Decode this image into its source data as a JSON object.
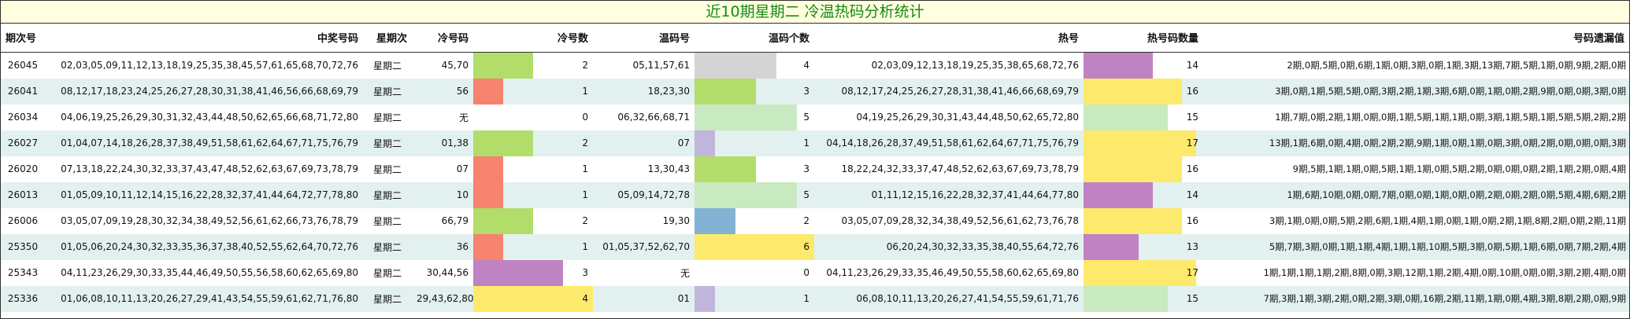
{
  "title": "近10期星期二 冷温热码分析统计",
  "headers": [
    "期次号",
    "中奖号码",
    "星期次",
    "冷号码",
    "冷号数",
    "温码号",
    "温码个数",
    "热号",
    "热号码数量",
    "号码遗漏值"
  ],
  "colors": {
    "green": "#b2dd6a",
    "red": "#f6836d",
    "purple": "#bf82c2",
    "yellow": "#fde96b",
    "gray": "#d4d4d4",
    "light_green": "#c9e9c1",
    "lavender": "#c0b6dd",
    "blue": "#82b3d4"
  },
  "rows": [
    {
      "issue": "26045",
      "numbers": "02,03,05,09,11,12,13,18,19,25,35,38,45,57,61,65,68,70,72,76",
      "weekday": "星期二",
      "cold": "45,70",
      "cold_count": 2,
      "cold_color": "#b2dd6a",
      "warm": "05,11,57,61",
      "warm_count": 4,
      "warm_color": "#d4d4d4",
      "hot": "02,03,09,12,13,18,19,25,35,38,65,68,72,76",
      "hot_count": 14,
      "hot_color": "#bf82c2",
      "missing": "2期,0期,5期,0期,6期,1期,0期,3期,0期,1期,3期,13期,7期,5期,1期,0期,9期,2期,0期"
    },
    {
      "issue": "26041",
      "numbers": "08,12,17,18,23,24,25,26,27,28,30,31,38,41,46,56,66,68,69,79",
      "weekday": "星期二",
      "cold": "56",
      "cold_count": 1,
      "cold_color": "#f6836d",
      "warm": "18,23,30",
      "warm_count": 3,
      "warm_color": "#b2dd6a",
      "hot": "08,12,17,24,25,26,27,28,31,38,41,46,66,68,69,79",
      "hot_count": 16,
      "hot_color": "#fde96b",
      "missing": "3期,0期,1期,5期,5期,0期,3期,2期,1期,3期,6期,0期,1期,0期,2期,9期,0期,0期,3期,0期"
    },
    {
      "issue": "26034",
      "numbers": "04,06,19,25,26,29,30,31,32,43,44,48,50,62,65,66,68,71,72,80",
      "weekday": "星期二",
      "cold": "无",
      "cold_count": 0,
      "cold_color": "#f6836d",
      "warm": "06,32,66,68,71",
      "warm_count": 5,
      "warm_color": "#c9e9c1",
      "hot": "04,19,25,26,29,30,31,43,44,48,50,62,65,72,80",
      "hot_count": 15,
      "hot_color": "#c9e9c1",
      "missing": "1期,7期,0期,2期,1期,0期,0期,1期,5期,1期,1期,0期,3期,1期,5期,1期,5期,5期,2期,2期"
    },
    {
      "issue": "26027",
      "numbers": "01,04,07,14,18,26,28,37,38,49,51,58,61,62,64,67,71,75,76,79",
      "weekday": "星期二",
      "cold": "01,38",
      "cold_count": 2,
      "cold_color": "#b2dd6a",
      "warm": "07",
      "warm_count": 1,
      "warm_color": "#c0b6dd",
      "hot": "04,14,18,26,28,37,49,51,58,61,62,64,67,71,75,76,79",
      "hot_count": 17,
      "hot_color": "#fde96b",
      "missing": "13期,1期,6期,0期,4期,0期,2期,2期,9期,1期,0期,1期,0期,3期,0期,2期,0期,0期,0期,3期"
    },
    {
      "issue": "26020",
      "numbers": "07,13,18,22,24,30,32,33,37,43,47,48,52,62,63,67,69,73,78,79",
      "weekday": "星期二",
      "cold": "07",
      "cold_count": 1,
      "cold_color": "#f6836d",
      "warm": "13,30,43",
      "warm_count": 3,
      "warm_color": "#b2dd6a",
      "hot": "18,22,24,32,33,37,47,48,52,62,63,67,69,73,78,79",
      "hot_count": 16,
      "hot_color": "#fde96b",
      "missing": "9期,5期,1期,1期,0期,5期,1期,1期,0期,5期,2期,0期,0期,0期,2期,1期,2期,0期,4期"
    },
    {
      "issue": "26013",
      "numbers": "01,05,09,10,11,12,14,15,16,22,28,32,37,41,44,64,72,77,78,80",
      "weekday": "星期二",
      "cold": "10",
      "cold_count": 1,
      "cold_color": "#f6836d",
      "warm": "05,09,14,72,78",
      "warm_count": 5,
      "warm_color": "#c9e9c1",
      "hot": "01,11,12,15,16,22,28,32,37,41,44,64,77,80",
      "hot_count": 14,
      "hot_color": "#bf82c2",
      "missing": "1期,6期,10期,0期,0期,7期,0期,0期,1期,0期,0期,2期,0期,2期,0期,5期,4期,6期,2期"
    },
    {
      "issue": "26006",
      "numbers": "03,05,07,09,19,28,30,32,34,38,49,52,56,61,62,66,73,76,78,79",
      "weekday": "星期二",
      "cold": "66,79",
      "cold_count": 2,
      "cold_color": "#b2dd6a",
      "warm": "19,30",
      "warm_count": 2,
      "warm_color": "#82b3d4",
      "hot": "03,05,07,09,28,32,34,38,49,52,56,61,62,73,76,78",
      "hot_count": 16,
      "hot_color": "#fde96b",
      "missing": "3期,1期,0期,0期,5期,2期,6期,1期,4期,1期,0期,1期,0期,2期,1期,8期,2期,0期,2期,11期"
    },
    {
      "issue": "25350",
      "numbers": "01,05,06,20,24,30,32,33,35,36,37,38,40,52,55,62,64,70,72,76",
      "weekday": "星期二",
      "cold": "36",
      "cold_count": 1,
      "cold_color": "#f6836d",
      "warm": "01,05,37,52,62,70",
      "warm_count": 6,
      "warm_color": "#fde96b",
      "hot": "06,20,24,30,32,33,35,38,40,55,64,72,76",
      "hot_count": 13,
      "hot_color": "#bf82c2",
      "missing": "5期,7期,3期,0期,1期,1期,4期,1期,1期,10期,5期,3期,0期,5期,1期,6期,0期,7期,2期,4期"
    },
    {
      "issue": "25343",
      "numbers": "04,11,23,26,29,30,33,35,44,46,49,50,55,56,58,60,62,65,69,80",
      "weekday": "星期二",
      "cold": "30,44,56",
      "cold_count": 3,
      "cold_color": "#bf82c2",
      "warm": "无",
      "warm_count": 0,
      "warm_color": "#d4d4d4",
      "hot": "04,11,23,26,29,33,35,46,49,50,55,58,60,62,65,69,80",
      "hot_count": 17,
      "hot_color": "#fde96b",
      "missing": "1期,1期,1期,1期,2期,8期,0期,3期,12期,1期,2期,4期,0期,10期,0期,0期,3期,2期,4期,0期"
    },
    {
      "issue": "25336",
      "numbers": "01,06,08,10,11,13,20,26,27,29,41,43,54,55,59,61,62,71,76,80",
      "weekday": "星期二",
      "cold": "29,43,62,80",
      "cold_count": 4,
      "cold_color": "#fde96b",
      "warm": "01",
      "warm_count": 1,
      "warm_color": "#c0b6dd",
      "hot": "06,08,10,11,13,20,26,27,41,54,55,59,61,71,76",
      "hot_count": 15,
      "hot_color": "#c9e9c1",
      "missing": "7期,3期,1期,3期,2期,0期,2期,3期,0期,16期,2期,11期,1期,0期,4期,3期,8期,2期,0期,9期"
    }
  ]
}
